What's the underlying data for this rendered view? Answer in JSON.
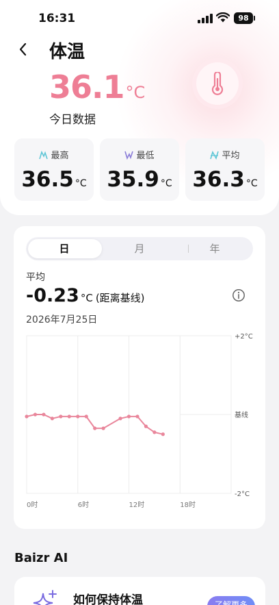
{
  "status_bar": {
    "time": "16:31",
    "battery": "98"
  },
  "header": {
    "title": "体温"
  },
  "today": {
    "value": "36.1",
    "unit": "°C",
    "label": "今日数据"
  },
  "stats": [
    {
      "label": "最高",
      "value": "36.5",
      "unit": "°C",
      "icon": "max-icon",
      "color": "#5ec6d6"
    },
    {
      "label": "最低",
      "value": "35.9",
      "unit": "°C",
      "icon": "min-icon",
      "color": "#8a7cd8"
    },
    {
      "label": "平均",
      "value": "36.3",
      "unit": "°C",
      "icon": "avg-icon",
      "color": "#5ec6d6"
    }
  ],
  "tabs": [
    {
      "label": "日",
      "active": true
    },
    {
      "label": "月",
      "active": false
    },
    {
      "label": "年",
      "active": false
    }
  ],
  "summary": {
    "label": "平均",
    "value": "-0.23",
    "unit": "°C",
    "note": "(距离基线)",
    "date": "2026年7月25日"
  },
  "chart_data": {
    "type": "line",
    "x_labels": [
      "0时",
      "6时",
      "12时",
      "18时"
    ],
    "y_labels": [
      "+2°C",
      "基线",
      "-2°C"
    ],
    "ylim": [
      -2,
      2
    ],
    "xlim": [
      0,
      24
    ],
    "color": "#e9869b",
    "series": [
      {
        "x": [
          0,
          1,
          2,
          3,
          4,
          5,
          6,
          7,
          8,
          9,
          11,
          12,
          13,
          14,
          15,
          16
        ],
        "y": [
          -0.05,
          0.0,
          0.0,
          -0.1,
          -0.05,
          -0.05,
          -0.05,
          -0.05,
          -0.35,
          -0.35,
          -0.1,
          -0.05,
          -0.05,
          -0.3,
          -0.45,
          -0.5
        ]
      }
    ]
  },
  "ai": {
    "title": "Baizr AI",
    "tip": "如何保持体温",
    "more_label": "了解更多"
  },
  "colors": {
    "accent": "#ee7e95",
    "line": "#e9869b"
  }
}
